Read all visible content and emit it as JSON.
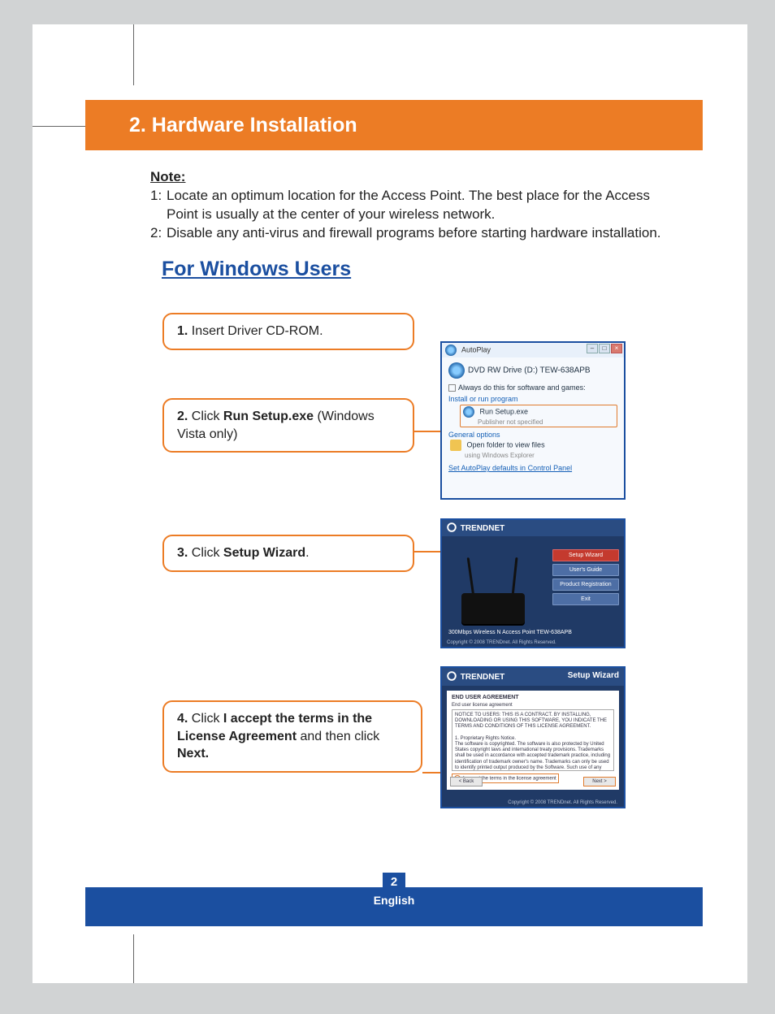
{
  "header": {
    "title": "2. Hardware Installation"
  },
  "note": {
    "label": "Note:",
    "items": [
      "Locate an optimum location for the Access Point. The best place for the Access Point is usually at the center of your wireless network.",
      "Disable any anti-virus and firewall programs before starting hardware installation."
    ]
  },
  "subheading": "For Windows Users",
  "steps": {
    "s1": {
      "num": "1.",
      "text": " Insert Driver CD-ROM."
    },
    "s2": {
      "num": "2.",
      "pre": " Click ",
      "bold": "Run Setup.exe",
      "post": " (Windows Vista only)"
    },
    "s3": {
      "num": "3.",
      "pre": " Click ",
      "bold": "Setup Wizard",
      "post": "."
    },
    "s4": {
      "num": "4.",
      "pre": " Click ",
      "bold1": "I accept the terms in the License Agreement",
      "mid": " and then click ",
      "bold2": "Next."
    }
  },
  "autoplay": {
    "title": "AutoPlay",
    "drive": "DVD RW Drive (D:) TEW-638APB",
    "always": "Always do this for software and games:",
    "section1": "Install or run program",
    "run_main": "Run Setup.exe",
    "run_sub": "Publisher not specified",
    "section2": "General options",
    "open_main": "Open folder to view files",
    "open_sub": "using Windows Explorer",
    "link": "Set AutoPlay defaults in Control Panel"
  },
  "wizard_menu": {
    "brand": "TRENDNET",
    "buttons": [
      "Setup Wizard",
      "User's Guide",
      "Product Registration",
      "Exit"
    ],
    "caption": "300Mbps Wireless N Access Point TEW-638APB",
    "copyright": "Copyright © 2008 TRENDnet. All Rights Reserved."
  },
  "license_dlg": {
    "brand": "TRENDNET",
    "title": "Setup Wizard",
    "heading": "END USER AGREEMENT",
    "subhead": "End user license agreement",
    "body": "NOTICE TO USERS: THIS IS A CONTRACT. BY INSTALLING, DOWNLOADING OR USING THIS SOFTWARE, YOU INDICATE THE TERMS AND CONDITIONS OF THIS LICENSE AGREEMENT.\n\n1. Proprietary Rights Notice.\nThe software is copyrighted. The software is also protected by United States copyright laws and international treaty provisions. Trademarks shall be used in accordance with accepted trademark practice, including identification of trademark owner's name. Trademarks can only be used to identify printed output produced by the Software. Such use of any trademark does not give you any rights of ownership in that trademark. Except as stated above, this Agreement does not grant you any...",
    "accept": "I accept the terms in the license agreement",
    "back": "< Back",
    "next": "Next >",
    "copyright": "Copyright © 2008 TRENDnet. All Rights Reserved."
  },
  "footer": {
    "page": "2",
    "lang": "English"
  }
}
